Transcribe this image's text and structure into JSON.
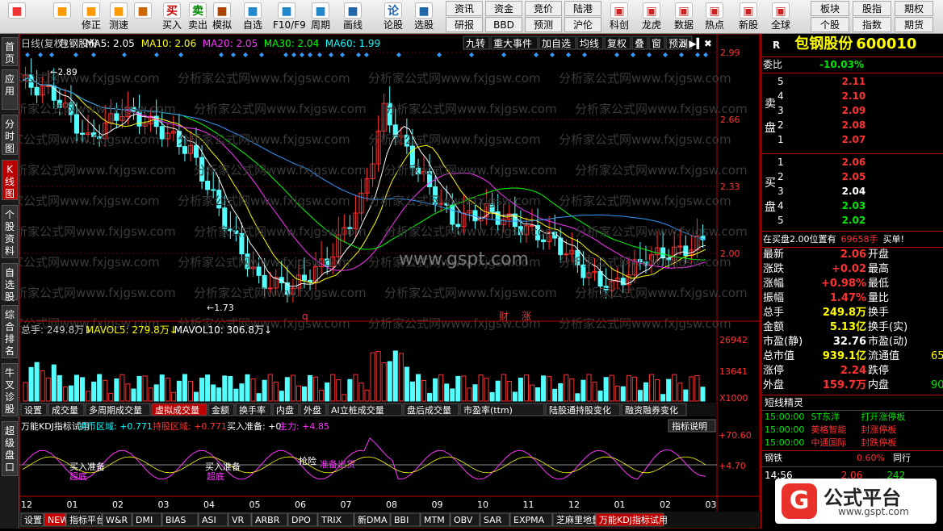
{
  "toolbar": {
    "buttons": [
      {
        "label": "",
        "icon": "windows-icon"
      },
      {
        "label": "",
        "icon": "back-arrow-icon"
      },
      {
        "label": "修正",
        "icon": "updown-icon"
      },
      {
        "label": "测速",
        "icon": "speed-icon"
      },
      {
        "label": "",
        "icon": "clock-icon"
      },
      {
        "label": "买入",
        "icon": "buy-icon",
        "glyph": "买"
      },
      {
        "label": "卖出",
        "icon": "sell-icon",
        "glyph": "卖"
      },
      {
        "label": "模拟",
        "icon": "hammer-icon"
      },
      {
        "label": "自选",
        "icon": "star-icon"
      },
      {
        "label": "F10/F9",
        "icon": "f10-icon"
      },
      {
        "label": "周期",
        "icon": "cycle-icon"
      },
      {
        "label": "画线",
        "icon": "pen-icon"
      },
      {
        "label": "论股",
        "icon": "talk-icon",
        "glyph": "论"
      },
      {
        "label": "选股",
        "icon": "search-icon"
      }
    ],
    "grid_buttons": [
      [
        "资讯",
        "资金",
        "竞价",
        "陆港"
      ],
      [
        "研报",
        "BBD",
        "预测",
        "沪伦"
      ]
    ],
    "right_buttons": [
      {
        "label": "科创",
        "icon": "chart-icon"
      },
      {
        "label": "龙虎",
        "icon": "tiger-icon"
      },
      {
        "label": "数据",
        "icon": "pe-icon"
      },
      {
        "label": "热点",
        "icon": "hot-icon"
      },
      {
        "label": "新股",
        "icon": "newstock-icon"
      },
      {
        "label": "全球",
        "icon": "globe-icon"
      }
    ],
    "right_grid": [
      [
        "板块",
        "股指",
        "期权"
      ],
      [
        "个股",
        "指数",
        "期货"
      ]
    ]
  },
  "lefttabs": [
    "首页",
    "应用",
    "分时图",
    "K线图",
    "个股资料",
    "自选股",
    "综合排名",
    "牛叉诊股",
    "超级盘口"
  ],
  "chart": {
    "header": {
      "period": "日线(复权)",
      "name": "包钢股份",
      "ma5": "MA5: 2.05",
      "ma10": "MA10: 2.06",
      "ma20": "MA20: 2.05",
      "ma30": "MA30: 2.04",
      "ma60": "MA60: 1.99"
    },
    "top_buttons": [
      "九转",
      "重大事件",
      "加自选",
      "均线",
      "复权",
      "叠",
      "窗",
      "预测"
    ],
    "price_axis": [
      "2.99",
      "2.66",
      "2.33",
      "2.00"
    ],
    "hi_label": "2.89",
    "lo_label": "1.73",
    "markers": [
      "q",
      "财",
      "涨"
    ],
    "watermark": "分析家公式网www.fxjgsw.com",
    "watermark2": "www.gspt.com",
    "vol_header": {
      "total": "总手: 249.8万",
      "mav5": "MAVOL5: 279.8万",
      "mav10": "MAVOL10: 306.8万"
    },
    "vol_axis": [
      "26942",
      "13641",
      "X1000"
    ],
    "mid_tabs": [
      "设置",
      "成交量",
      "多周期成交量",
      "虚拟成交量",
      "金额",
      "换手率",
      "内盘",
      "外盘",
      "AI立桩成交量",
      "盘后成交量",
      "市盈率(ttm)",
      "陆股通持股变化",
      "融资融券变化"
    ],
    "kdj_header": {
      "name": "万能KDJ指标试用",
      "hold": "持币区域: +0.771",
      "holdstock": "持股区域: +0.771",
      "buyprep": "买入准备: +0",
      "main": "主力: +4.85"
    },
    "kdj_button": "指标说明",
    "kdj_axis": [
      "+70.60",
      "+4.70"
    ],
    "kdj_labels": [
      "买入准备",
      "超底",
      "买入准备",
      "超底",
      "抢险",
      "准备出货"
    ],
    "months": [
      "12",
      "01",
      "02",
      "03",
      "04",
      "05",
      "06",
      "07",
      "08",
      "09",
      "10",
      "11",
      "12",
      "01",
      "02",
      "03"
    ],
    "bottom_tabs": [
      "设置",
      "NEW",
      "指标平台",
      "W&R",
      "DMI",
      "BIAS",
      "ASI",
      "VR",
      "ARBR",
      "DPO",
      "TRIX",
      "新DMA",
      "BBI",
      "MTM",
      "OBV",
      "SAR",
      "EXPMA",
      "芝麻里地量",
      "万能KDJ指标试用"
    ]
  },
  "quote": {
    "r": "R",
    "name": "包钢股份",
    "code": "600010",
    "weibi_label": "委比",
    "weibi": "-10.03%",
    "sell_label": [
      "卖",
      "盘"
    ],
    "buy_label": [
      "买",
      "盘"
    ],
    "sell": [
      {
        "lvl": "5",
        "price": "2.11"
      },
      {
        "lvl": "4",
        "price": "2.10"
      },
      {
        "lvl": "3",
        "price": "2.09"
      },
      {
        "lvl": "2",
        "price": "2.08"
      },
      {
        "lvl": "1",
        "price": "2.07"
      }
    ],
    "buy": [
      {
        "lvl": "1",
        "price": "2.06"
      },
      {
        "lvl": "2",
        "price": "2.05"
      },
      {
        "lvl": "3",
        "price": "2.04"
      },
      {
        "lvl": "4",
        "price": "2.03"
      },
      {
        "lvl": "5",
        "price": "2.02"
      }
    ],
    "in_market": "在买盘2.00位置有",
    "in_qty": "69658手",
    "in_buy": "买单!",
    "stats": [
      {
        "l": "最新",
        "v": "2.06",
        "r": "开盘"
      },
      {
        "l": "涨跌",
        "v": "+0.02",
        "r": "最高"
      },
      {
        "l": "涨幅",
        "v": "+0.98%",
        "r": "最低"
      },
      {
        "l": "振幅",
        "v": "1.47%",
        "r": "量比"
      },
      {
        "l": "总手",
        "v": "249.8万",
        "r": "换手"
      },
      {
        "l": "金额",
        "v": "5.13亿",
        "r": "换手(实)"
      },
      {
        "l": "市盈(静)",
        "v": "32.76",
        "r": "市盈(动)"
      },
      {
        "l": "总市值",
        "v": "939.1亿",
        "r": "流通值",
        "r2": "65"
      },
      {
        "l": "涨停",
        "v": "2.24",
        "r": "跌停"
      },
      {
        "l": "外盘",
        "v": "159.7万",
        "r": "内盘",
        "r2": "90"
      }
    ],
    "jingling": "短线精灵",
    "news": [
      {
        "t": "15:00:00",
        "n": "ST东洋",
        "e": "打开涨停板"
      },
      {
        "t": "15:00:00",
        "n": "美格智能",
        "e": "封涨停板"
      },
      {
        "t": "15:00:00",
        "n": "中通国际",
        "e": "封跌停板"
      }
    ],
    "sector": "钢铁",
    "sector_pct": "0.60%",
    "tongxing": "同行",
    "tick": {
      "t": "14:56",
      "p": "2.06",
      "q": "242"
    }
  },
  "logo": {
    "text": "公式平台",
    "url": "www.gspt.com"
  }
}
